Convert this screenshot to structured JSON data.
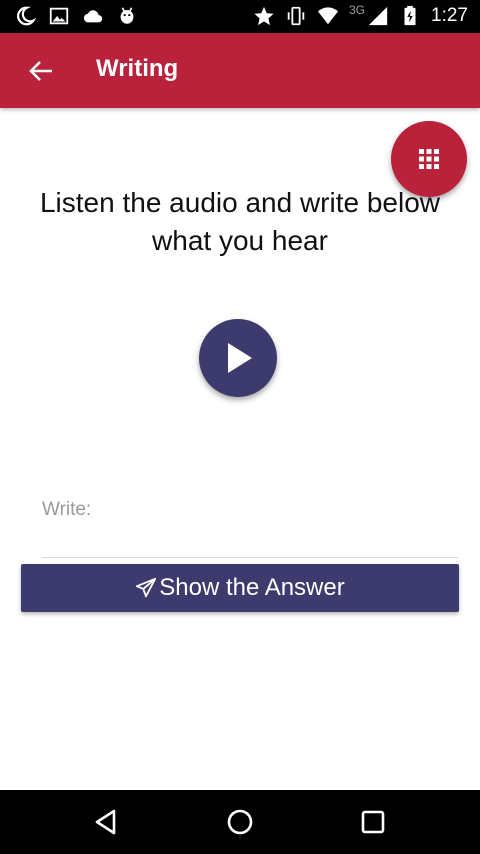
{
  "status_bar": {
    "network_label": "3G",
    "time": "1:27",
    "left_icons": [
      "moon-icon",
      "image-icon",
      "cloud-icon",
      "android-icon"
    ],
    "right_icons": [
      "star-icon",
      "vibrate-icon",
      "wifi-icon",
      "signal-icon",
      "battery-charging-icon"
    ]
  },
  "app_bar": {
    "title": "Writing",
    "background_color": "#b9223a"
  },
  "fab": {
    "icon": "grid-icon",
    "color": "#b9223a"
  },
  "main": {
    "instruction": "Listen the audio and write below what you hear",
    "play_icon": "play-icon",
    "write_placeholder": "Write:",
    "write_value": "",
    "show_answer_label": "Show the Answer",
    "show_answer_icon": "paper-plane-icon",
    "accent_color": "#3d3b6e"
  },
  "nav_bar": {
    "icons": [
      "back-triangle-icon",
      "home-circle-icon",
      "recents-square-icon"
    ]
  }
}
